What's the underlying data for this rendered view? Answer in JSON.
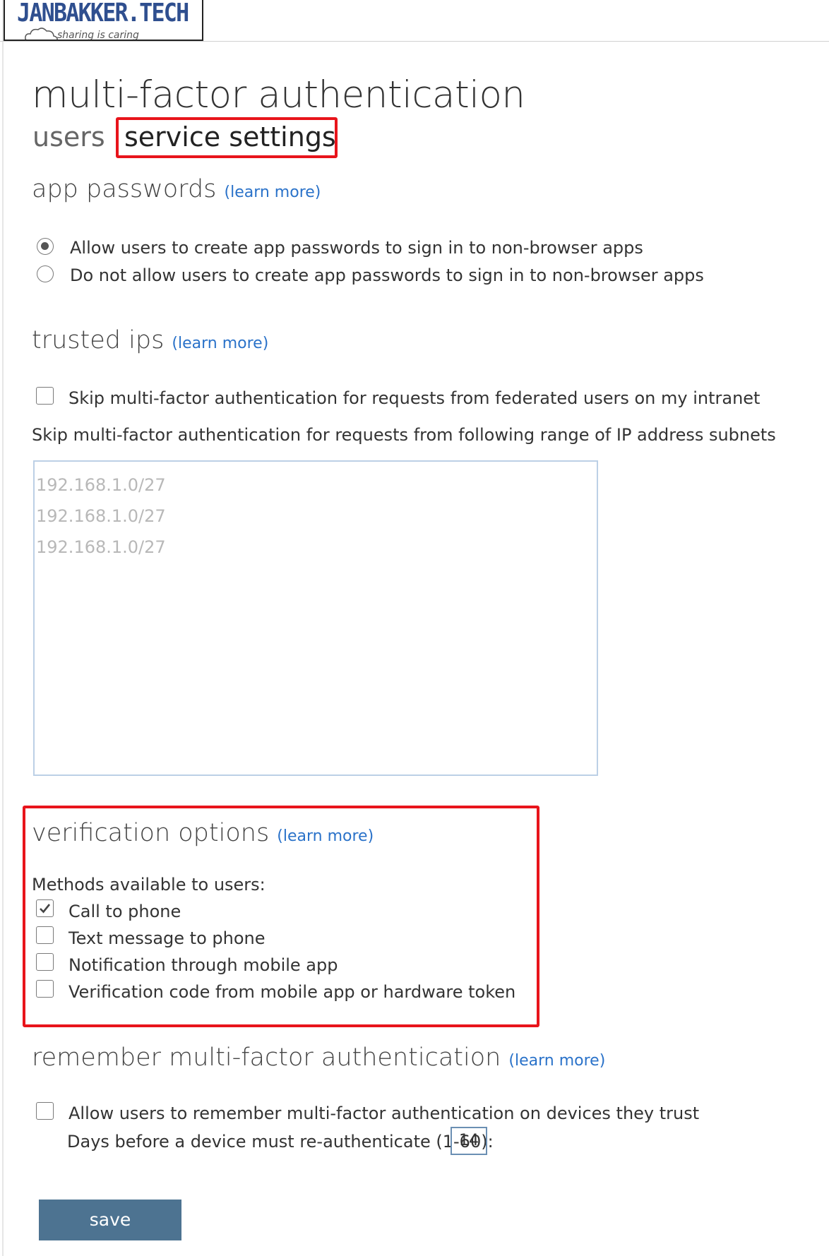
{
  "logo": {
    "text": "JANBAKKER.TECH",
    "tagline": "sharing is caring"
  },
  "page": {
    "title": "multi-factor authentication"
  },
  "tabs": [
    {
      "label": "users"
    },
    {
      "label": "service settings",
      "selected": true
    }
  ],
  "app_passwords": {
    "heading": "app passwords",
    "learn_more": "(learn more)",
    "options": [
      {
        "label": "Allow users to create app passwords to sign in to non-browser apps",
        "selected": true
      },
      {
        "label": "Do not allow users to create app passwords to sign in to non-browser apps",
        "selected": false
      }
    ]
  },
  "trusted_ips": {
    "heading": "trusted ips",
    "learn_more": "(learn more)",
    "skip_federated": {
      "label": "Skip multi-factor authentication for requests from federated users on my intranet",
      "checked": false
    },
    "subnets_label": "Skip multi-factor authentication for requests from following range of IP address subnets",
    "subnets_placeholder": [
      "192.168.1.0/27",
      "192.168.1.0/27",
      "192.168.1.0/27"
    ]
  },
  "verification_options": {
    "heading": "verification options",
    "learn_more": "(learn more)",
    "methods_label": "Methods available to users:",
    "methods": [
      {
        "label": "Call to phone",
        "checked": true
      },
      {
        "label": "Text message to phone",
        "checked": false
      },
      {
        "label": "Notification through mobile app",
        "checked": false
      },
      {
        "label": "Verification code from mobile app or hardware token",
        "checked": false
      }
    ]
  },
  "remember_mfa": {
    "heading": "remember multi-factor authentication",
    "learn_more": "(learn more)",
    "allow": {
      "label": "Allow users to remember multi-factor authentication on devices they trust",
      "checked": false
    },
    "days_label": "Days before a device must re-authenticate (1-60):",
    "days_value": "14"
  },
  "actions": {
    "save_label": "save"
  },
  "colors": {
    "accent_link": "#2a72c9",
    "highlight_red": "#e8141b",
    "save_button": "#4d7391"
  }
}
